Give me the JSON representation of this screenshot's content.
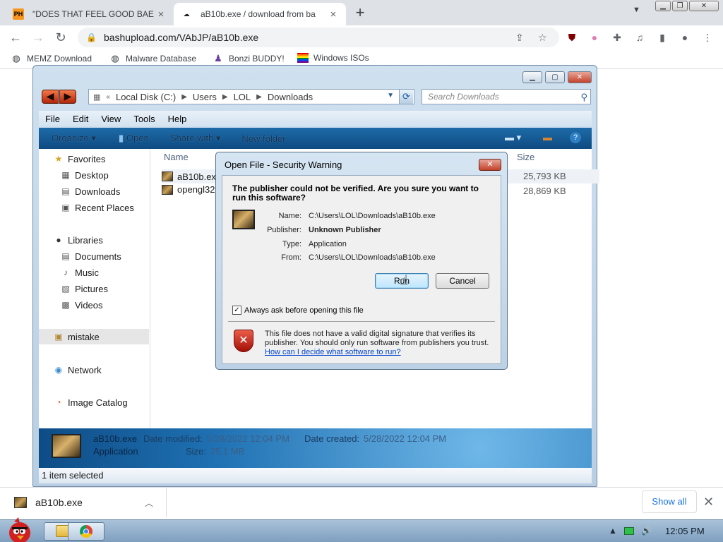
{
  "browser": {
    "tabs": [
      {
        "title": "\"DOES THAT FEEL GOOD BAE",
        "favicon": "PH"
      },
      {
        "title": "aB10b.exe / download from ba"
      }
    ],
    "url": "bashupload.com/VAbJP/aB10b.exe",
    "bookmarks": [
      "MEMZ Download",
      "Malware Database",
      "Bonzi BUDDY!",
      "Windows ISOs"
    ]
  },
  "explorer": {
    "address": {
      "crumbs": [
        "Local Disk (C:)",
        "Users",
        "LOL",
        "Downloads"
      ]
    },
    "search_placeholder": "Search Downloads",
    "menu": [
      "File",
      "Edit",
      "View",
      "Tools",
      "Help"
    ],
    "commands": [
      "Organize ▾",
      "Open",
      "Share with ▾",
      "New folder"
    ],
    "nav": {
      "favorites": "Favorites",
      "desktop": "Desktop",
      "downloads": "Downloads",
      "recent": "Recent Places",
      "libraries": "Libraries",
      "documents": "Documents",
      "music": "Music",
      "pictures": "Pictures",
      "videos": "Videos",
      "mistake": "mistake",
      "network": "Network",
      "image_catalog": "Image Catalog"
    },
    "columns": {
      "name": "Name",
      "size": "Size"
    },
    "files": [
      {
        "name": "aB10b.exe",
        "size": "25,793 KB"
      },
      {
        "name": "opengl32",
        "size": "28,869 KB"
      }
    ],
    "details": {
      "filename": "aB10b.exe",
      "type": "Application",
      "modified_label": "Date modified:",
      "modified": "5/28/2022 12:04 PM",
      "created_label": "Date created:",
      "created": "5/28/2022 12:04 PM",
      "size_label": "Size:",
      "size": "25.1 MB"
    },
    "status": "1 item selected"
  },
  "dialog": {
    "title": "Open File - Security Warning",
    "question": "The publisher could not be verified.  Are you sure you want to run this software?",
    "fields": [
      {
        "label": "Name:",
        "value": "C:\\Users\\LOL\\Downloads\\aB10b.exe"
      },
      {
        "label": "Publisher:",
        "value": "Unknown Publisher"
      },
      {
        "label": "Type:",
        "value": "Application"
      },
      {
        "label": "From:",
        "value": "C:\\Users\\LOL\\Downloads\\aB10b.exe"
      }
    ],
    "run_label": "Run",
    "cancel_label": "Cancel",
    "checkbox_label": "Always ask before opening this file",
    "checkbox_checked": true,
    "warning": "This file does not have a valid digital signature that verifies its publisher.  You should only run software from publishers you trust.",
    "link": "How can I decide what software to run?"
  },
  "downloads": {
    "file": "aB10b.exe",
    "show_all": "Show all"
  },
  "taskbar": {
    "clock": "12:05 PM"
  }
}
